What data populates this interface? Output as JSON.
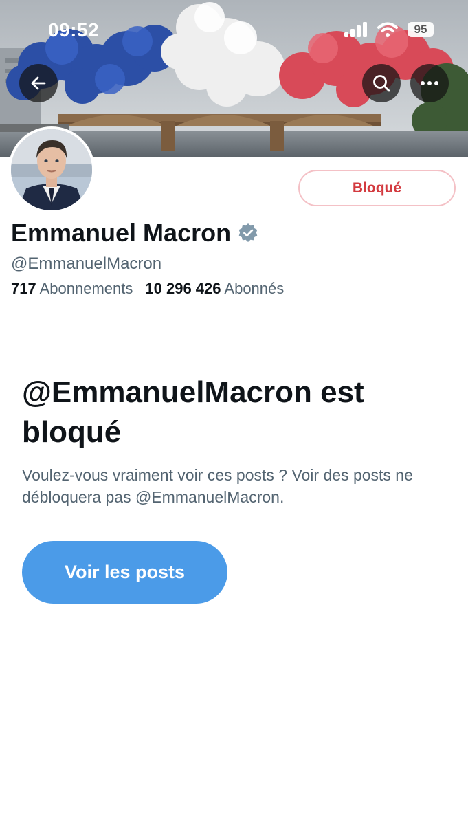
{
  "status_bar": {
    "time": "09:52",
    "battery": "95"
  },
  "profile": {
    "name": "Emmanuel Macron",
    "handle": "@EmmanuelMacron",
    "following_count": "717",
    "following_label": "Abonnements",
    "followers_count": "10 296 426",
    "followers_label": "Abonnés",
    "blocked_button_label": "Bloqué"
  },
  "blocked_notice": {
    "title": "@EmmanuelMacron est bloqué",
    "description": "Voulez-vous vraiment voir ces posts ? Voir des posts ne débloquera pas @EmmanuelMacron.",
    "view_posts_label": "Voir les posts"
  },
  "icons": {
    "back": "back-arrow-icon",
    "search": "search-icon",
    "more": "more-options-icon",
    "verified": "verified-badge-icon"
  },
  "colors": {
    "blocked_accent": "#d33a3f",
    "primary_button": "#4b9be8",
    "secondary_text": "#536471",
    "verified_badge": "#829aab"
  }
}
